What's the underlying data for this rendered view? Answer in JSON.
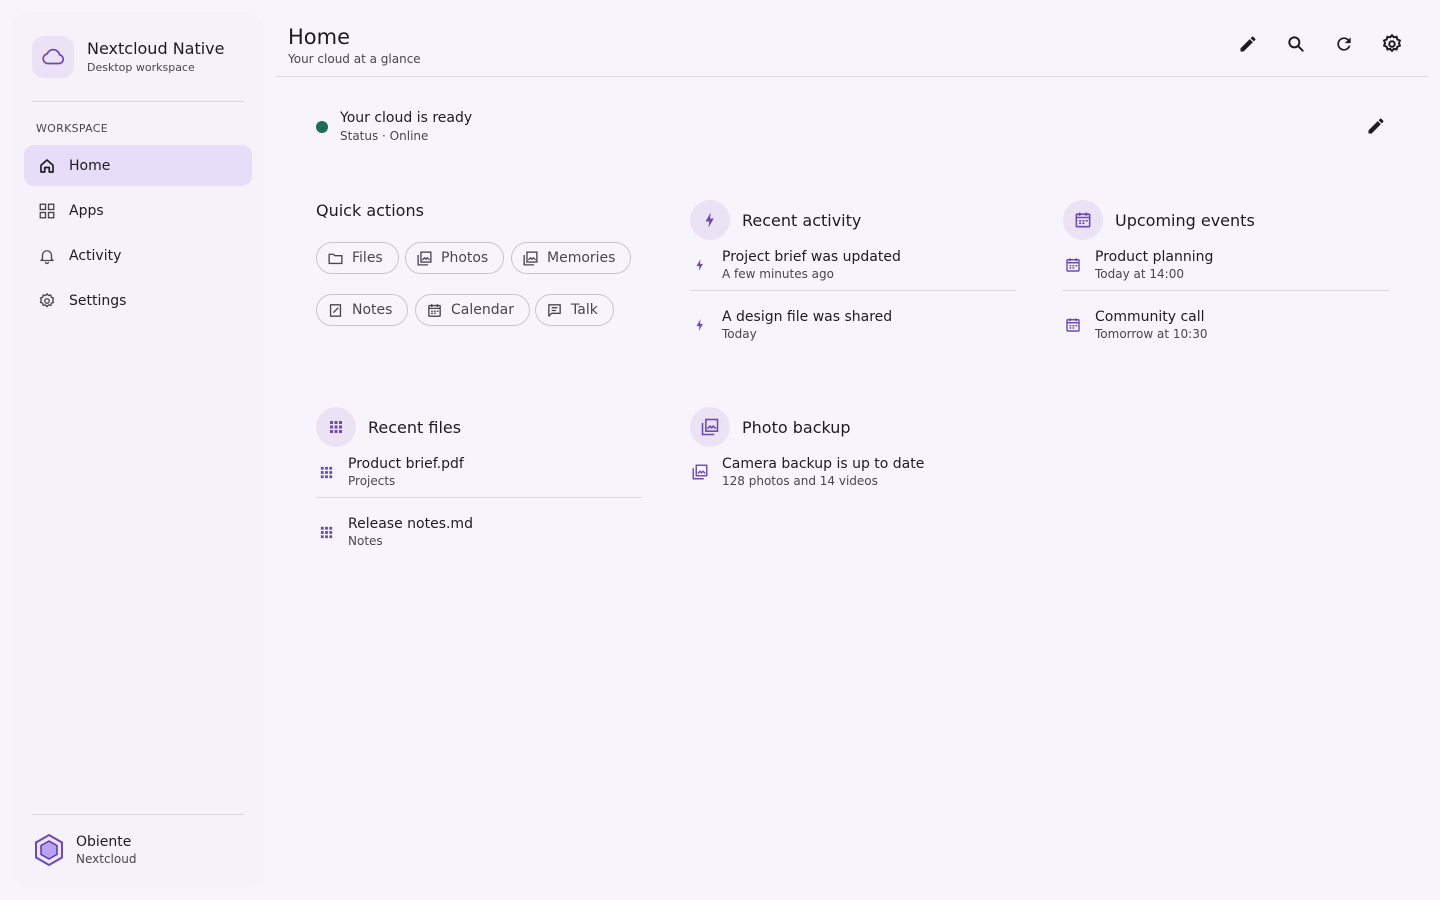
{
  "colors": {
    "accent": "#6c4ab0",
    "active_nav": "#e8ddf8",
    "status_online": "#1f6b5c"
  },
  "brand": {
    "title": "Nextcloud Native",
    "subtitle": "Desktop workspace",
    "icon": "cloud-icon"
  },
  "sidebar": {
    "section_label": "WORKSPACE",
    "items": [
      {
        "label": "Home",
        "icon": "home-icon",
        "active": true
      },
      {
        "label": "Apps",
        "icon": "grid-icon",
        "active": false
      },
      {
        "label": "Activity",
        "icon": "bell-icon",
        "active": false
      },
      {
        "label": "Settings",
        "icon": "gear-icon",
        "active": false
      }
    ]
  },
  "user": {
    "name": "Obiente",
    "subtitle": "Nextcloud",
    "icon": "hexagon-avatar-icon"
  },
  "header": {
    "title": "Home",
    "subtitle": "Your cloud at a glance",
    "actions": [
      "edit-icon",
      "search-icon",
      "refresh-icon",
      "settings-icon"
    ]
  },
  "status": {
    "title": "Your cloud is ready",
    "subtitle": "Status · Online"
  },
  "quick_actions": {
    "title": "Quick actions",
    "chips": [
      {
        "label": "Files",
        "icon": "folder-icon"
      },
      {
        "label": "Photos",
        "icon": "photos-icon"
      },
      {
        "label": "Memories",
        "icon": "photos-icon"
      },
      {
        "label": "Notes",
        "icon": "note-icon"
      },
      {
        "label": "Calendar",
        "icon": "calendar-icon"
      },
      {
        "label": "Talk",
        "icon": "chat-icon"
      }
    ]
  },
  "recent_activity": {
    "title": "Recent activity",
    "items": [
      {
        "title": "Project brief was updated",
        "subtitle": "A few minutes ago"
      },
      {
        "title": "A design file was shared",
        "subtitle": "Today"
      }
    ]
  },
  "upcoming_events": {
    "title": "Upcoming events",
    "items": [
      {
        "title": "Product planning",
        "subtitle": "Today at 14:00"
      },
      {
        "title": "Community call",
        "subtitle": "Tomorrow at 10:30"
      }
    ]
  },
  "recent_files": {
    "title": "Recent files",
    "items": [
      {
        "title": "Product brief.pdf",
        "subtitle": "Projects"
      },
      {
        "title": "Release notes.md",
        "subtitle": "Notes"
      }
    ]
  },
  "photo_backup": {
    "title": "Photo backup",
    "items": [
      {
        "title": "Camera backup is up to date",
        "subtitle": "128 photos and 14 videos"
      }
    ]
  }
}
